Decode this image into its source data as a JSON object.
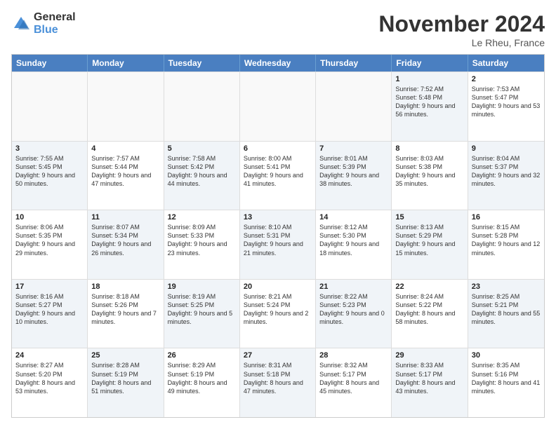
{
  "logo": {
    "general": "General",
    "blue": "Blue"
  },
  "title": "November 2024",
  "location": "Le Rheu, France",
  "header_days": [
    "Sunday",
    "Monday",
    "Tuesday",
    "Wednesday",
    "Thursday",
    "Friday",
    "Saturday"
  ],
  "weeks": [
    [
      {
        "day": "",
        "info": "",
        "shaded": false,
        "empty": true
      },
      {
        "day": "",
        "info": "",
        "shaded": false,
        "empty": true
      },
      {
        "day": "",
        "info": "",
        "shaded": false,
        "empty": true
      },
      {
        "day": "",
        "info": "",
        "shaded": false,
        "empty": true
      },
      {
        "day": "",
        "info": "",
        "shaded": false,
        "empty": true
      },
      {
        "day": "1",
        "info": "Sunrise: 7:52 AM\nSunset: 5:48 PM\nDaylight: 9 hours and 56 minutes.",
        "shaded": true,
        "empty": false
      },
      {
        "day": "2",
        "info": "Sunrise: 7:53 AM\nSunset: 5:47 PM\nDaylight: 9 hours and 53 minutes.",
        "shaded": false,
        "empty": false
      }
    ],
    [
      {
        "day": "3",
        "info": "Sunrise: 7:55 AM\nSunset: 5:45 PM\nDaylight: 9 hours and 50 minutes.",
        "shaded": true,
        "empty": false
      },
      {
        "day": "4",
        "info": "Sunrise: 7:57 AM\nSunset: 5:44 PM\nDaylight: 9 hours and 47 minutes.",
        "shaded": false,
        "empty": false
      },
      {
        "day": "5",
        "info": "Sunrise: 7:58 AM\nSunset: 5:42 PM\nDaylight: 9 hours and 44 minutes.",
        "shaded": true,
        "empty": false
      },
      {
        "day": "6",
        "info": "Sunrise: 8:00 AM\nSunset: 5:41 PM\nDaylight: 9 hours and 41 minutes.",
        "shaded": false,
        "empty": false
      },
      {
        "day": "7",
        "info": "Sunrise: 8:01 AM\nSunset: 5:39 PM\nDaylight: 9 hours and 38 minutes.",
        "shaded": true,
        "empty": false
      },
      {
        "day": "8",
        "info": "Sunrise: 8:03 AM\nSunset: 5:38 PM\nDaylight: 9 hours and 35 minutes.",
        "shaded": false,
        "empty": false
      },
      {
        "day": "9",
        "info": "Sunrise: 8:04 AM\nSunset: 5:37 PM\nDaylight: 9 hours and 32 minutes.",
        "shaded": true,
        "empty": false
      }
    ],
    [
      {
        "day": "10",
        "info": "Sunrise: 8:06 AM\nSunset: 5:35 PM\nDaylight: 9 hours and 29 minutes.",
        "shaded": false,
        "empty": false
      },
      {
        "day": "11",
        "info": "Sunrise: 8:07 AM\nSunset: 5:34 PM\nDaylight: 9 hours and 26 minutes.",
        "shaded": true,
        "empty": false
      },
      {
        "day": "12",
        "info": "Sunrise: 8:09 AM\nSunset: 5:33 PM\nDaylight: 9 hours and 23 minutes.",
        "shaded": false,
        "empty": false
      },
      {
        "day": "13",
        "info": "Sunrise: 8:10 AM\nSunset: 5:31 PM\nDaylight: 9 hours and 21 minutes.",
        "shaded": true,
        "empty": false
      },
      {
        "day": "14",
        "info": "Sunrise: 8:12 AM\nSunset: 5:30 PM\nDaylight: 9 hours and 18 minutes.",
        "shaded": false,
        "empty": false
      },
      {
        "day": "15",
        "info": "Sunrise: 8:13 AM\nSunset: 5:29 PM\nDaylight: 9 hours and 15 minutes.",
        "shaded": true,
        "empty": false
      },
      {
        "day": "16",
        "info": "Sunrise: 8:15 AM\nSunset: 5:28 PM\nDaylight: 9 hours and 12 minutes.",
        "shaded": false,
        "empty": false
      }
    ],
    [
      {
        "day": "17",
        "info": "Sunrise: 8:16 AM\nSunset: 5:27 PM\nDaylight: 9 hours and 10 minutes.",
        "shaded": true,
        "empty": false
      },
      {
        "day": "18",
        "info": "Sunrise: 8:18 AM\nSunset: 5:26 PM\nDaylight: 9 hours and 7 minutes.",
        "shaded": false,
        "empty": false
      },
      {
        "day": "19",
        "info": "Sunrise: 8:19 AM\nSunset: 5:25 PM\nDaylight: 9 hours and 5 minutes.",
        "shaded": true,
        "empty": false
      },
      {
        "day": "20",
        "info": "Sunrise: 8:21 AM\nSunset: 5:24 PM\nDaylight: 9 hours and 2 minutes.",
        "shaded": false,
        "empty": false
      },
      {
        "day": "21",
        "info": "Sunrise: 8:22 AM\nSunset: 5:23 PM\nDaylight: 9 hours and 0 minutes.",
        "shaded": true,
        "empty": false
      },
      {
        "day": "22",
        "info": "Sunrise: 8:24 AM\nSunset: 5:22 PM\nDaylight: 8 hours and 58 minutes.",
        "shaded": false,
        "empty": false
      },
      {
        "day": "23",
        "info": "Sunrise: 8:25 AM\nSunset: 5:21 PM\nDaylight: 8 hours and 55 minutes.",
        "shaded": true,
        "empty": false
      }
    ],
    [
      {
        "day": "24",
        "info": "Sunrise: 8:27 AM\nSunset: 5:20 PM\nDaylight: 8 hours and 53 minutes.",
        "shaded": false,
        "empty": false
      },
      {
        "day": "25",
        "info": "Sunrise: 8:28 AM\nSunset: 5:19 PM\nDaylight: 8 hours and 51 minutes.",
        "shaded": true,
        "empty": false
      },
      {
        "day": "26",
        "info": "Sunrise: 8:29 AM\nSunset: 5:19 PM\nDaylight: 8 hours and 49 minutes.",
        "shaded": false,
        "empty": false
      },
      {
        "day": "27",
        "info": "Sunrise: 8:31 AM\nSunset: 5:18 PM\nDaylight: 8 hours and 47 minutes.",
        "shaded": true,
        "empty": false
      },
      {
        "day": "28",
        "info": "Sunrise: 8:32 AM\nSunset: 5:17 PM\nDaylight: 8 hours and 45 minutes.",
        "shaded": false,
        "empty": false
      },
      {
        "day": "29",
        "info": "Sunrise: 8:33 AM\nSunset: 5:17 PM\nDaylight: 8 hours and 43 minutes.",
        "shaded": true,
        "empty": false
      },
      {
        "day": "30",
        "info": "Sunrise: 8:35 AM\nSunset: 5:16 PM\nDaylight: 8 hours and 41 minutes.",
        "shaded": false,
        "empty": false
      }
    ]
  ]
}
